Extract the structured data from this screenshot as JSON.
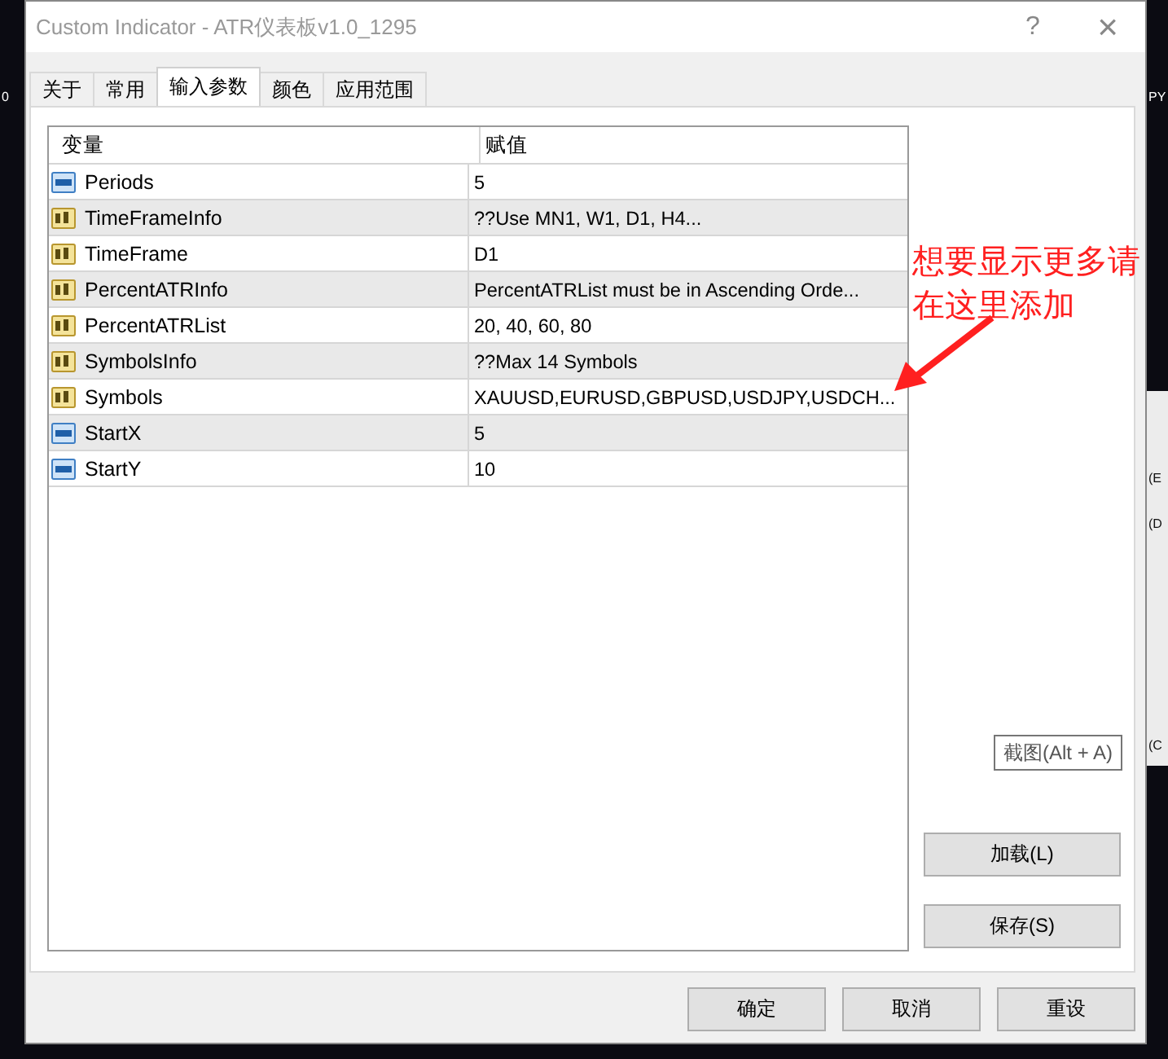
{
  "window": {
    "title": "Custom Indicator - ATR仪表板v1.0_1295",
    "help": "?",
    "close": "×"
  },
  "tabs": [
    {
      "label": "关于",
      "selected": false
    },
    {
      "label": "常用",
      "selected": false
    },
    {
      "label": "输入参数",
      "selected": true
    },
    {
      "label": "颜色",
      "selected": false
    },
    {
      "label": "应用范围",
      "selected": false
    }
  ],
  "table": {
    "columns": [
      "变量",
      "赋值"
    ],
    "rows": [
      {
        "kind": "int",
        "name": "Periods",
        "value": "5"
      },
      {
        "kind": "string",
        "name": "TimeFrameInfo",
        "value": "??Use MN1, W1, D1, H4..."
      },
      {
        "kind": "string",
        "name": "TimeFrame",
        "value": "D1"
      },
      {
        "kind": "string",
        "name": "PercentATRInfo",
        "value": "PercentATRList must be in Ascending Orde..."
      },
      {
        "kind": "string",
        "name": "PercentATRList",
        "value": "20, 40, 60, 80"
      },
      {
        "kind": "string",
        "name": "SymbolsInfo",
        "value": "??Max 14 Symbols"
      },
      {
        "kind": "string",
        "name": "Symbols",
        "value": "XAUUSD,EURUSD,GBPUSD,USDJPY,USDCH..."
      },
      {
        "kind": "int",
        "name": "StartX",
        "value": "5"
      },
      {
        "kind": "int",
        "name": "StartY",
        "value": "10"
      }
    ]
  },
  "side_buttons": [
    "加载(L)",
    "保存(S)"
  ],
  "tooltip": "截图(Alt + A)",
  "annotation": "想要显示更多请在这里添加",
  "buttons": [
    "确定",
    "取消",
    "重设"
  ],
  "left_background_text": [
    "0"
  ],
  "right_background_text": [
    "PY",
    "(E",
    "(D",
    "(C"
  ]
}
